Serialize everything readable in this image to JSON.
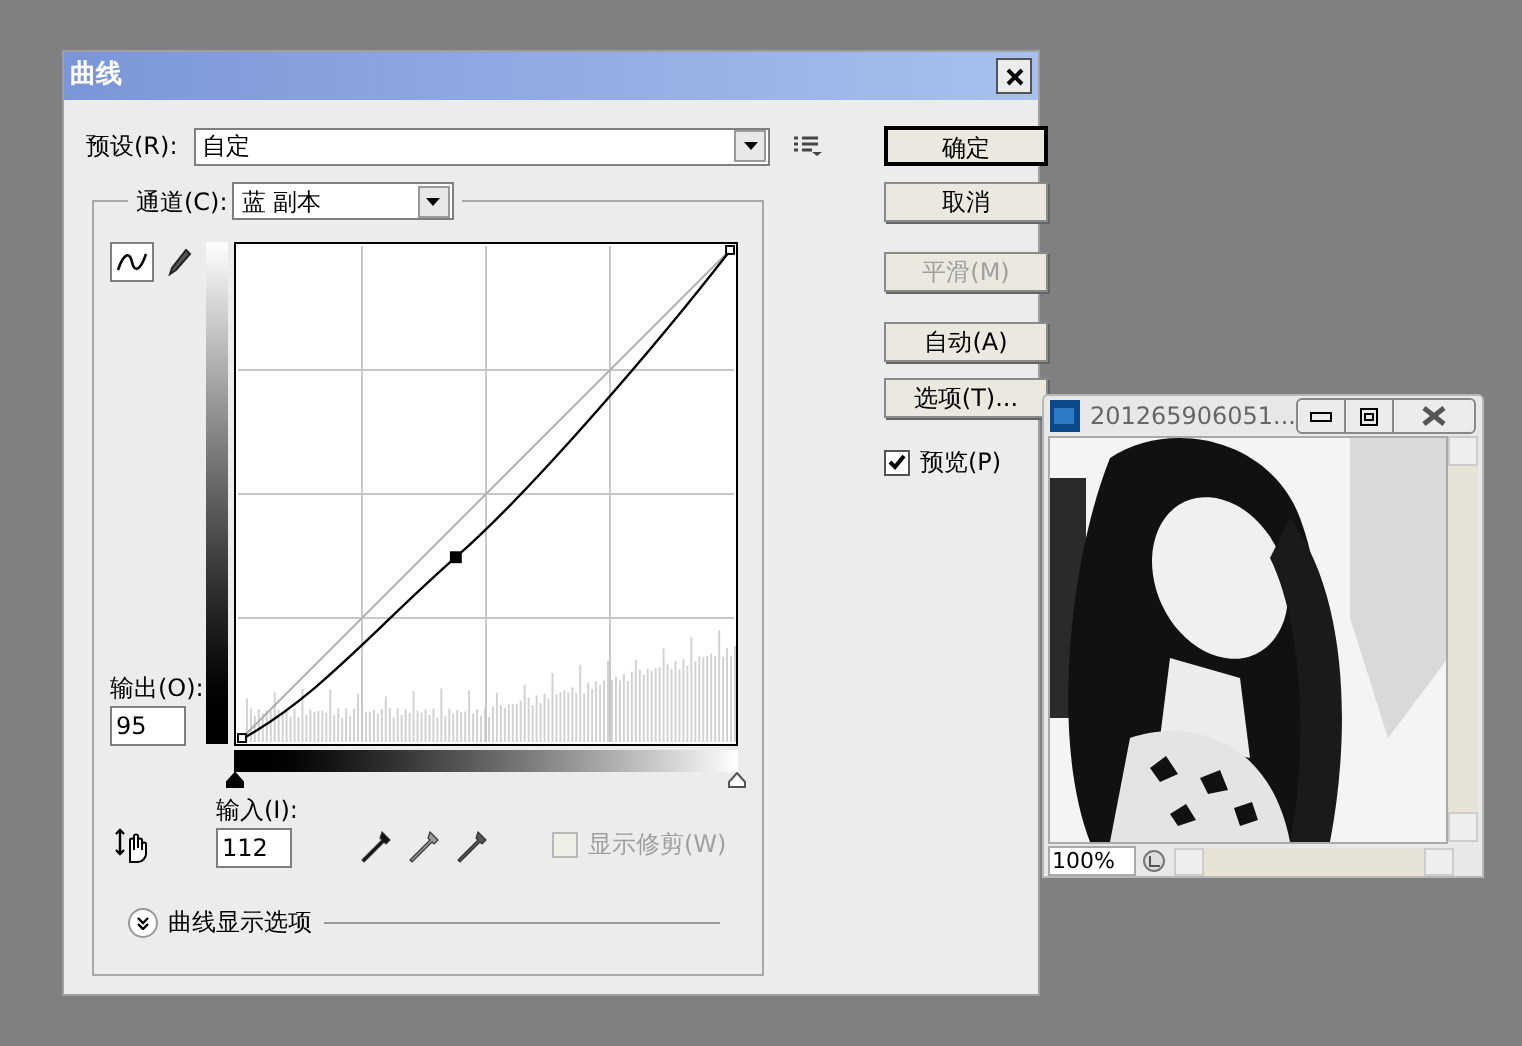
{
  "window": {
    "title": "曲线"
  },
  "preset": {
    "label": "预设(R):",
    "value": "自定"
  },
  "buttons": [
    {
      "label": "确定",
      "disabled": false,
      "default": true
    },
    {
      "label": "取消",
      "disabled": false,
      "default": false
    },
    {
      "label": "平滑(M)",
      "disabled": true,
      "default": false
    },
    {
      "label": "自动(A)",
      "disabled": false,
      "default": false
    },
    {
      "label": "选项(T)...",
      "disabled": false,
      "default": false
    }
  ],
  "preview": {
    "label": "预览(P)",
    "checked": true
  },
  "channel": {
    "label": "通道(C):",
    "value": "蓝 副本"
  },
  "tools": [
    {
      "kind": "curve",
      "selected": true
    },
    {
      "kind": "pencil",
      "selected": false
    }
  ],
  "output": {
    "label": "输出(O):",
    "value": "95"
  },
  "input": {
    "label": "输入(I):",
    "value": "112"
  },
  "input_sliders": [
    {
      "level": 0
    },
    {
      "level": 1
    }
  ],
  "show_clipping": {
    "label": "显示修剪(W)",
    "checked": false,
    "disabled": true
  },
  "display_options": {
    "label": "曲线显示选项",
    "expanded": false
  },
  "image_window": {
    "title": "201265906051...",
    "zoom": "100%"
  }
}
